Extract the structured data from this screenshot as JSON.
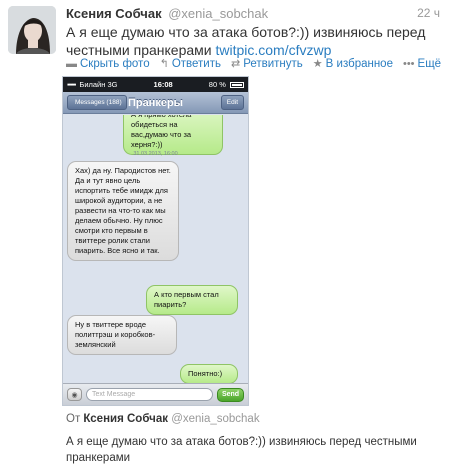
{
  "tweet": {
    "author_name": "Ксения Собчак",
    "author_handle": "@xenia_sobchak",
    "time": "22 ч",
    "text": "А я еще думаю что за атака ботов?:)) извиняюсь перед честными пранкерами",
    "link": "twitpic.com/cfvzwp",
    "actions": {
      "hide_photo": "Скрыть фото",
      "reply": "Ответить",
      "retweet": "Ретвитнуть",
      "favorite": "В избранное",
      "more": "Ещё"
    }
  },
  "phone": {
    "statusbar": {
      "carrier": "Билайн",
      "network": "3G",
      "clock": "16:08",
      "battery": "80 %"
    },
    "navbar": {
      "back_label": "Messages (188)",
      "title": "Пранкеры",
      "edit_label": "Edit"
    },
    "messages": [
      {
        "direction": "out",
        "text": "А я прямо хотела обидеться на вас,думаю что за херня?:))"
      },
      {
        "direction": "stamp",
        "text": "31.03.2013, 16:00"
      },
      {
        "direction": "in",
        "text": "Хах) да ну. Пародистов нет. Да и тут явно цель испортить тебе имидж для широкой аудитории, а не развести на что-то как мы делаем обычно. Ну плюс смотри кто первым в твиттере ролик стали пиарить. Все ясно и так."
      },
      {
        "direction": "out",
        "text": "А кто первым стал пиарить?"
      },
      {
        "direction": "in",
        "text": "Ну в твиттере вроде политтрэш и коробков-землянский"
      },
      {
        "direction": "out",
        "text": "Понятно:)"
      }
    ],
    "input": {
      "placeholder": "Text Message",
      "send_label": "Send"
    }
  },
  "footer": {
    "via_prefix": "От",
    "via_name": "Ксения Собчак",
    "via_handle": "@xenia_sobchak",
    "text": "А я еще думаю что за атака ботов?:)) извиняюсь перед честными пранкерами"
  },
  "colors": {
    "link": "#2a7dc0",
    "outgoing_bubble": "#b6ea8a",
    "incoming_bubble": "#dcdcdc",
    "navbar": "#8498b6",
    "send_button": "#4aa52a"
  }
}
